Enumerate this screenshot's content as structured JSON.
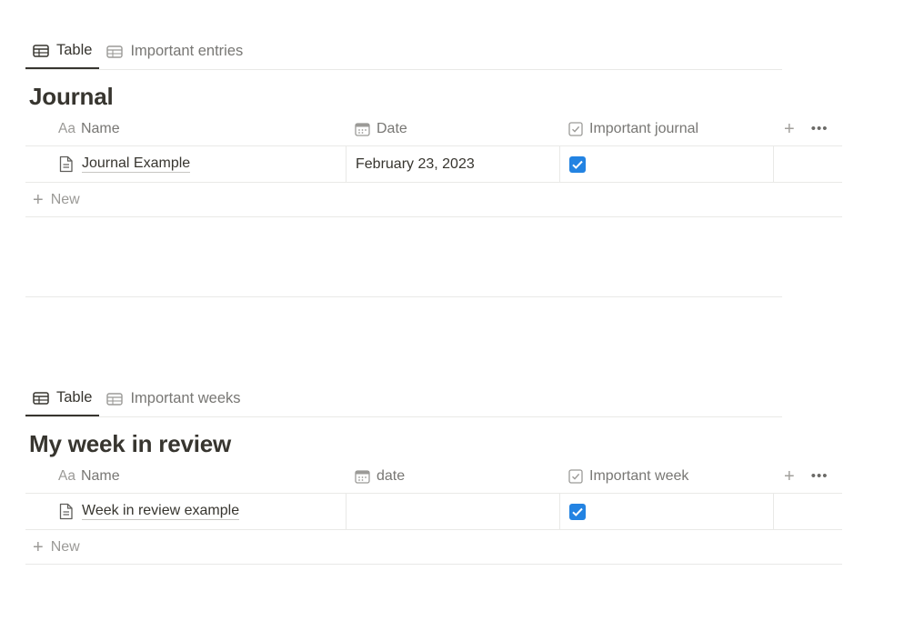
{
  "databases": [
    {
      "views": [
        {
          "label": "Table",
          "icon": "table-icon",
          "active": true
        },
        {
          "label": "Important entries",
          "icon": "table-icon",
          "active": false
        }
      ],
      "title": "Journal",
      "columns": {
        "name": {
          "prefix": "Aa",
          "label": "Name"
        },
        "date": {
          "icon": "calendar-icon",
          "label": "Date"
        },
        "check": {
          "icon": "checkbox-icon",
          "label": "Important journal"
        }
      },
      "rows": [
        {
          "name": "Journal Example",
          "date": "February 23, 2023",
          "checked": true
        }
      ],
      "new_label": "New"
    },
    {
      "views": [
        {
          "label": "Table",
          "icon": "table-icon",
          "active": true
        },
        {
          "label": "Important weeks",
          "icon": "table-icon",
          "active": false
        }
      ],
      "title": "My week in review",
      "columns": {
        "name": {
          "prefix": "Aa",
          "label": "Name"
        },
        "date": {
          "icon": "calendar-icon",
          "label": "date"
        },
        "check": {
          "icon": "checkbox-icon",
          "label": "Important week"
        }
      },
      "rows": [
        {
          "name": "Week in review example",
          "date": "",
          "checked": true
        }
      ],
      "new_label": "New"
    }
  ],
  "colors": {
    "accent": "#2383e2",
    "text": "#37352f",
    "muted": "#787774",
    "border": "#e9e9e7"
  }
}
